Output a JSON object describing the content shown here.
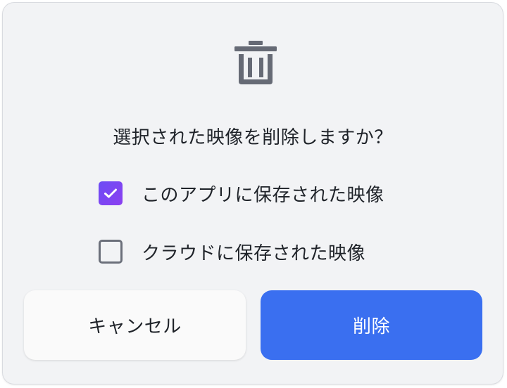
{
  "dialog": {
    "title": "選択された映像を削除しますか？",
    "icon": "trash-icon",
    "options": [
      {
        "label": "このアプリに保存された映像",
        "checked": true
      },
      {
        "label": "クラウドに保存された映像",
        "checked": false
      }
    ],
    "buttons": {
      "cancel_label": "キャンセル",
      "delete_label": "削除"
    },
    "colors": {
      "accent": "#3a6ff0",
      "checkbox_checked": "#7a45f2",
      "icon": "#6b6f7a",
      "background": "#f2f3f5"
    }
  }
}
